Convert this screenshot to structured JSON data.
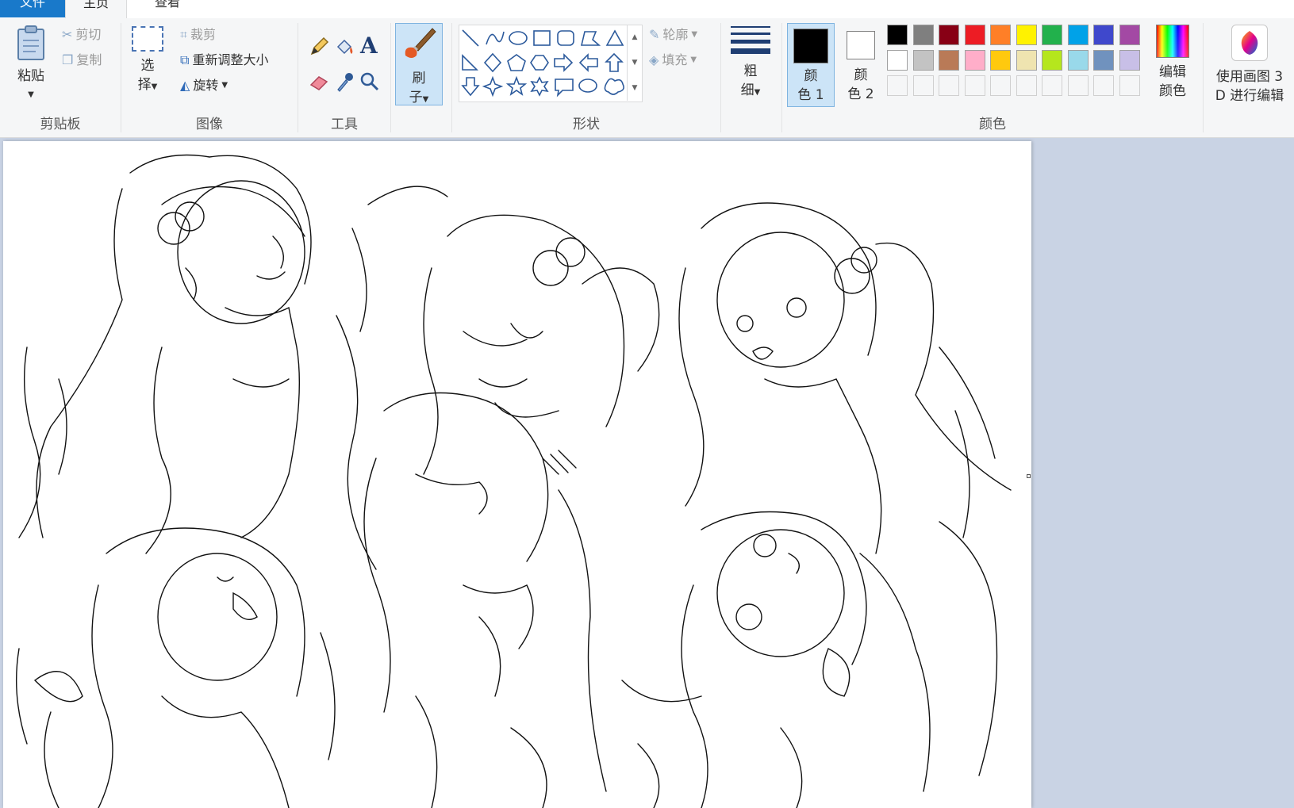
{
  "tabs": {
    "file": "文件",
    "home": "主页",
    "view": "查看"
  },
  "clipboard": {
    "paste": "粘贴",
    "cut": "剪切",
    "copy": "复制",
    "label": "剪贴板"
  },
  "image": {
    "select_1": "选",
    "select_2": "择",
    "crop": "裁剪",
    "resize": "重新调整大小",
    "rotate": "旋转",
    "label": "图像"
  },
  "tools": {
    "label": "工具"
  },
  "brushes": {
    "label_1": "刷",
    "label_2": "子"
  },
  "shapes": {
    "outline": "轮廓",
    "fill": "填充",
    "label": "形状"
  },
  "size": {
    "label_1": "粗",
    "label_2": "细"
  },
  "colors": {
    "color1_1": "颜",
    "color1_2": "色 1",
    "color2_1": "颜",
    "color2_2": "色 2",
    "edit_1": "编辑",
    "edit_2": "颜色",
    "label": "颜色",
    "color1_value": "#000000",
    "color2_value": "#ffffff",
    "palette_row1": [
      "#000000",
      "#7f7f7f",
      "#880015",
      "#ed1c24",
      "#ff7f27",
      "#fff200",
      "#22b14c",
      "#00a2e8",
      "#3f48cc",
      "#a349a4"
    ],
    "palette_row2": [
      "#ffffff",
      "#c3c3c3",
      "#b97a57",
      "#ffaec9",
      "#ffc90e",
      "#efe4b0",
      "#b5e61d",
      "#99d9ea",
      "#7092be",
      "#c8bfe7"
    ]
  },
  "paint3d": {
    "label_1": "使用画图 3",
    "label_2": "D 进行编辑"
  }
}
